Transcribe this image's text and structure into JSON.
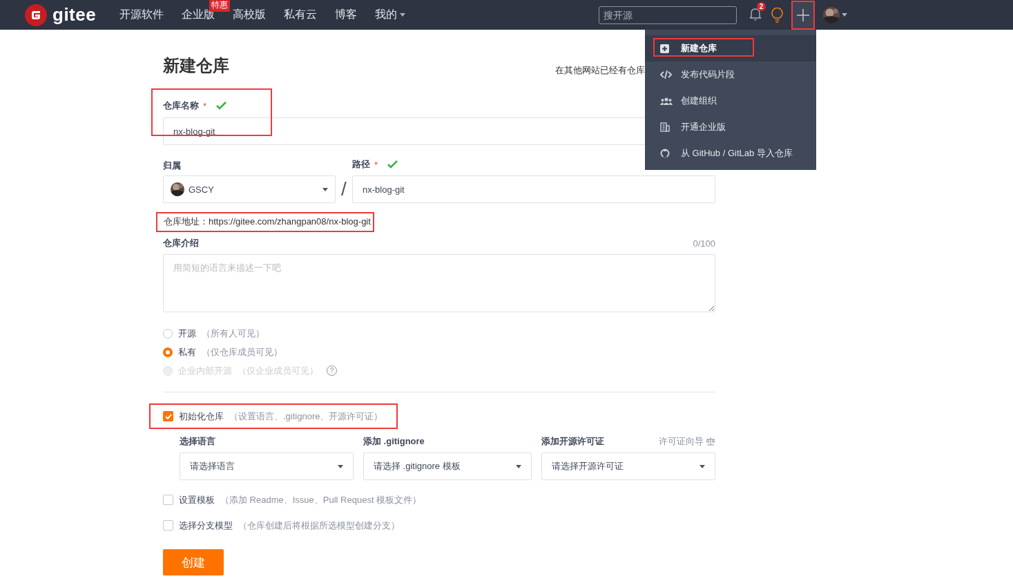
{
  "navbar": {
    "logo": "gitee",
    "links": [
      {
        "label": "开源软件"
      },
      {
        "label": "企业版",
        "badge": "特惠"
      },
      {
        "label": "高校版"
      },
      {
        "label": "私有云"
      },
      {
        "label": "博客"
      },
      {
        "label": "我的",
        "dropdown": true
      }
    ],
    "search": {
      "placeholder": "搜开源"
    },
    "notification_count": "2",
    "plus_annotated": true
  },
  "create_menu": {
    "items": [
      {
        "label": "新建仓库",
        "selected": true,
        "annotated": true
      },
      {
        "label": "发布代码片段",
        "selected": false,
        "annotated": false
      },
      {
        "label": "创建组织",
        "selected": false,
        "annotated": false
      },
      {
        "label": "开通企业版",
        "selected": false,
        "annotated": false
      },
      {
        "label": "从 GitHub / GitLab 导入仓库",
        "selected": false,
        "annotated": false
      }
    ]
  },
  "page": {
    "title": "新建仓库",
    "import_hint": "在其他网站已经有仓库"
  },
  "form": {
    "name": {
      "label": "仓库名称",
      "required": "*",
      "valid": true,
      "value": "nx-blog-git",
      "annotated": true
    },
    "owner": {
      "label": "归属",
      "value": "GSCY"
    },
    "separator": "/",
    "path": {
      "label": "路径",
      "required": "*",
      "valid": true,
      "value": "nx-blog-git"
    },
    "address": {
      "label": "仓库地址：",
      "url": "https://gitee.com/zhangpan08/nx-blog-git",
      "annotated": true
    },
    "intro": {
      "label": "仓库介绍",
      "counter": "0/100",
      "placeholder": "用简短的语言来描述一下吧"
    },
    "visibility": [
      {
        "label": "开源",
        "hint": "（所有人可见）",
        "selected": false,
        "disabled": false
      },
      {
        "label": "私有",
        "hint": "（仅仓库成员可见）",
        "selected": true,
        "disabled": false
      },
      {
        "label": "企业内部开源",
        "hint": "（仅企业成员可见）",
        "selected": false,
        "disabled": true,
        "help": "?"
      }
    ],
    "init": {
      "label": "初始化仓库",
      "hint": "（设置语言、.gitignore、开源许可证）",
      "checked": true,
      "annotated": true
    },
    "init_selects": [
      {
        "label": "选择语言",
        "value": "请选择语言"
      },
      {
        "label": "添加 .gitignore",
        "value": "请选择 .gitignore 模板"
      },
      {
        "label": "添加开源许可证",
        "value": "请选择开源许可证",
        "link": "许可证向导"
      }
    ],
    "options": [
      {
        "label": "设置模板",
        "hint": "（添加 Readme、Issue、Pull Request 模板文件）",
        "checked": false
      },
      {
        "label": "选择分支模型",
        "hint": "（仓库创建后将根据所选模型创建分支）",
        "checked": false
      }
    ],
    "submit": "创建"
  }
}
